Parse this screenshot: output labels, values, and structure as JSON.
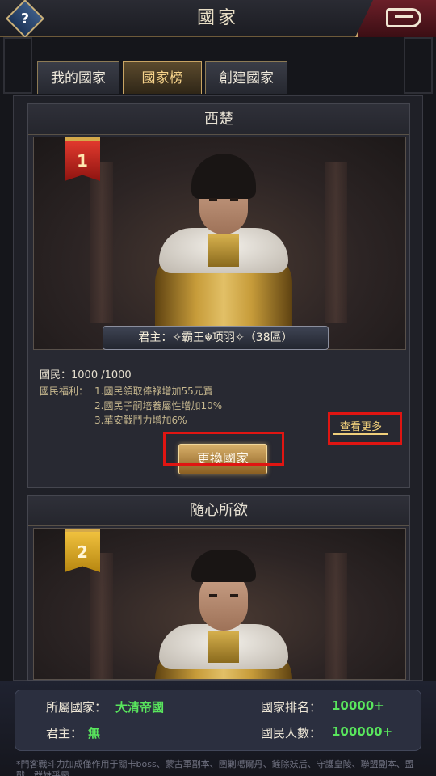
{
  "header": {
    "title": "國家",
    "help_label": "?"
  },
  "tabs": [
    {
      "label": "我的國家",
      "active": false
    },
    {
      "label": "國家榜",
      "active": true
    },
    {
      "label": "創建國家",
      "active": false
    }
  ],
  "nations": [
    {
      "name": "西楚",
      "rank": "1",
      "ruler_line": "君主：✧霸王☬项羽✧（38區）",
      "citizens": "國民：1000 /1000",
      "benefit_label": "國民福利：",
      "benefits": [
        "1.國民領取俸祿增加55元寶",
        "2.國民子嗣培養屬性增加10%",
        "3.華安戰鬥力增加6%"
      ],
      "see_more": "查看更多",
      "action": "更換國家"
    },
    {
      "name": "隨心所欲",
      "rank": "2"
    }
  ],
  "summary": {
    "nation_label": "所屬國家：",
    "nation_value": "大清帝國",
    "ruler_label": "君主：",
    "ruler_value": "無",
    "rank_label": "國家排名：",
    "rank_value": "10000+",
    "citizens_label": "國民人數：",
    "citizens_value": "100000+"
  },
  "footnote": "*門客戰斗力加成僅作用于關卡boss、蒙古軍副本、團剿噶爾丹、鏟除妖后、守護皇陵、聯盟副本、盟戰、群雄爭霸",
  "colors": {
    "accent_gold": "#f0cf7b",
    "value_green": "#59e65d",
    "highlight_red": "#e01512",
    "rank1_red": "#e23a2e",
    "rank2_gold": "#f0c13e"
  }
}
